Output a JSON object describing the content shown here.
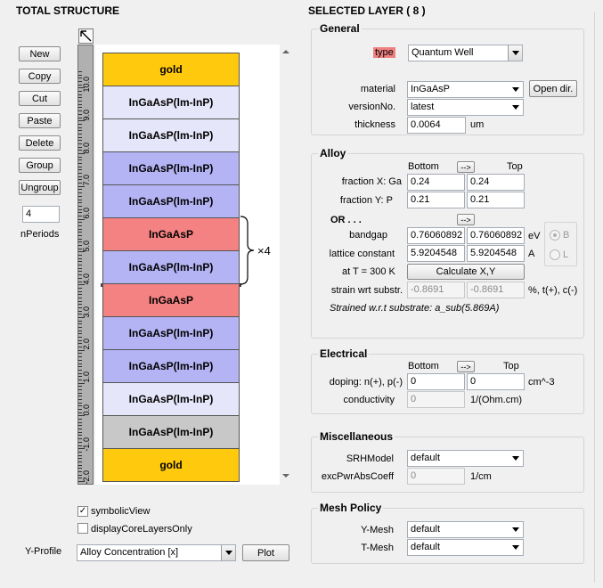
{
  "left": {
    "title": "TOTAL STRUCTURE",
    "buttons": {
      "new": "New",
      "copy": "Copy",
      "cut": "Cut",
      "paste": "Paste",
      "delete": "Delete",
      "group": "Group",
      "ungroup": "Ungroup"
    },
    "n_periods_value": "4",
    "n_periods_label": "nPeriods",
    "ruler_labels": [
      "10.0",
      "9.0",
      "8.0",
      "7.0",
      "6.0",
      "5.0",
      "4.0",
      "3.0",
      "2.0",
      "1.0",
      "0.0",
      "-1.0",
      "-2.0"
    ],
    "layers": [
      {
        "label": "gold",
        "color": "#ffc90e"
      },
      {
        "label": "InGaAsP(lm-InP)",
        "color": "#e6e6fa"
      },
      {
        "label": "InGaAsP(lm-InP)",
        "color": "#e6e6fa"
      },
      {
        "label": "InGaAsP(lm-InP)",
        "color": "#b4b4f5"
      },
      {
        "label": "InGaAsP(lm-InP)",
        "color": "#b4b4f5"
      },
      {
        "label": "InGaAsP",
        "color": "#f58282"
      },
      {
        "label": "InGaAsP(lm-InP)",
        "color": "#b4b4f5"
      },
      {
        "label": "InGaAsP",
        "color": "#f58282"
      },
      {
        "label": "InGaAsP(lm-InP)",
        "color": "#b4b4f5"
      },
      {
        "label": "InGaAsP(lm-InP)",
        "color": "#b4b4f5"
      },
      {
        "label": "InGaAsP(lm-InP)",
        "color": "#e6e6fa"
      },
      {
        "label": "InGaAsP(lm-InP)",
        "color": "#c8c8c8"
      },
      {
        "label": "gold",
        "color": "#ffc90e"
      }
    ],
    "period_marker": "×4",
    "symbolic_view_label": "symbolicView",
    "display_core_label": "displayCoreLayersOnly",
    "y_profile_label": "Y-Profile",
    "y_profile_value": "Alloy Concentration [x]",
    "plot_label": "Plot"
  },
  "right": {
    "title": "SELECTED LAYER  ( 8 )",
    "general": {
      "title": "General",
      "type_label": "type",
      "type_value": "Quantum Well",
      "material_label": "material",
      "material_value": "InGaAsP",
      "open_dir": "Open dir.",
      "version_label": "versionNo.",
      "version_value": "latest",
      "thickness_label": "thickness",
      "thickness_value": "0.0064",
      "thickness_unit": "um"
    },
    "alloy": {
      "title": "Alloy",
      "bottom": "Bottom",
      "top": "Top",
      "arrow": "-->",
      "fx_label": "fraction X: Ga",
      "fx_bottom": "0.24",
      "fx_top": "0.24",
      "fy_label": "fraction Y: P",
      "fy_bottom": "0.21",
      "fy_top": "0.21",
      "or_label": "OR . . .",
      "bandgap_label": "bandgap",
      "bandgap_bottom": "0.76060892",
      "bandgap_top": "0.76060892",
      "bandgap_unit": "eV",
      "lattice_label": "lattice constant",
      "lattice_bottom": "5.9204548",
      "lattice_top": "5.9204548",
      "lattice_unit": "A",
      "radio_b": "B",
      "radio_l": "L",
      "temp_label": "at T = 300 K",
      "calc_button": "Calculate X,Y",
      "strain_label": "strain wrt substr.",
      "strain_bottom": "-0.8691",
      "strain_top": "-0.8691",
      "strain_unit": "%, t(+), c(-)",
      "strain_note": "Strained w.r.t substrate: a_sub(5.869A)"
    },
    "electrical": {
      "title": "Electrical",
      "bottom": "Bottom",
      "top": "Top",
      "arrow": "-->",
      "doping_label": "doping: n(+), p(-)",
      "doping_bottom": "0",
      "doping_top": "0",
      "doping_unit": "cm^-3",
      "cond_label": "conductivity",
      "cond_value": "0",
      "cond_unit": "1/(Ohm.cm)"
    },
    "misc": {
      "title": "Miscellaneous",
      "srh_label": "SRHModel",
      "srh_value": "default",
      "exc_label": "excPwrAbsCoeff",
      "exc_value": "0",
      "exc_unit": "1/cm"
    },
    "mesh": {
      "title": "Mesh Policy",
      "ymesh_label": "Y-Mesh",
      "ymesh_value": "default",
      "tmesh_label": "T-Mesh",
      "tmesh_value": "default"
    }
  },
  "colors": {
    "type_highlight": "#f08080",
    "gold": "#ffc90e",
    "quantum_well": "#f58282",
    "barrier_dark": "#b4b4f5",
    "barrier_light": "#e6e6fa",
    "substrate_gray": "#c8c8c8"
  }
}
